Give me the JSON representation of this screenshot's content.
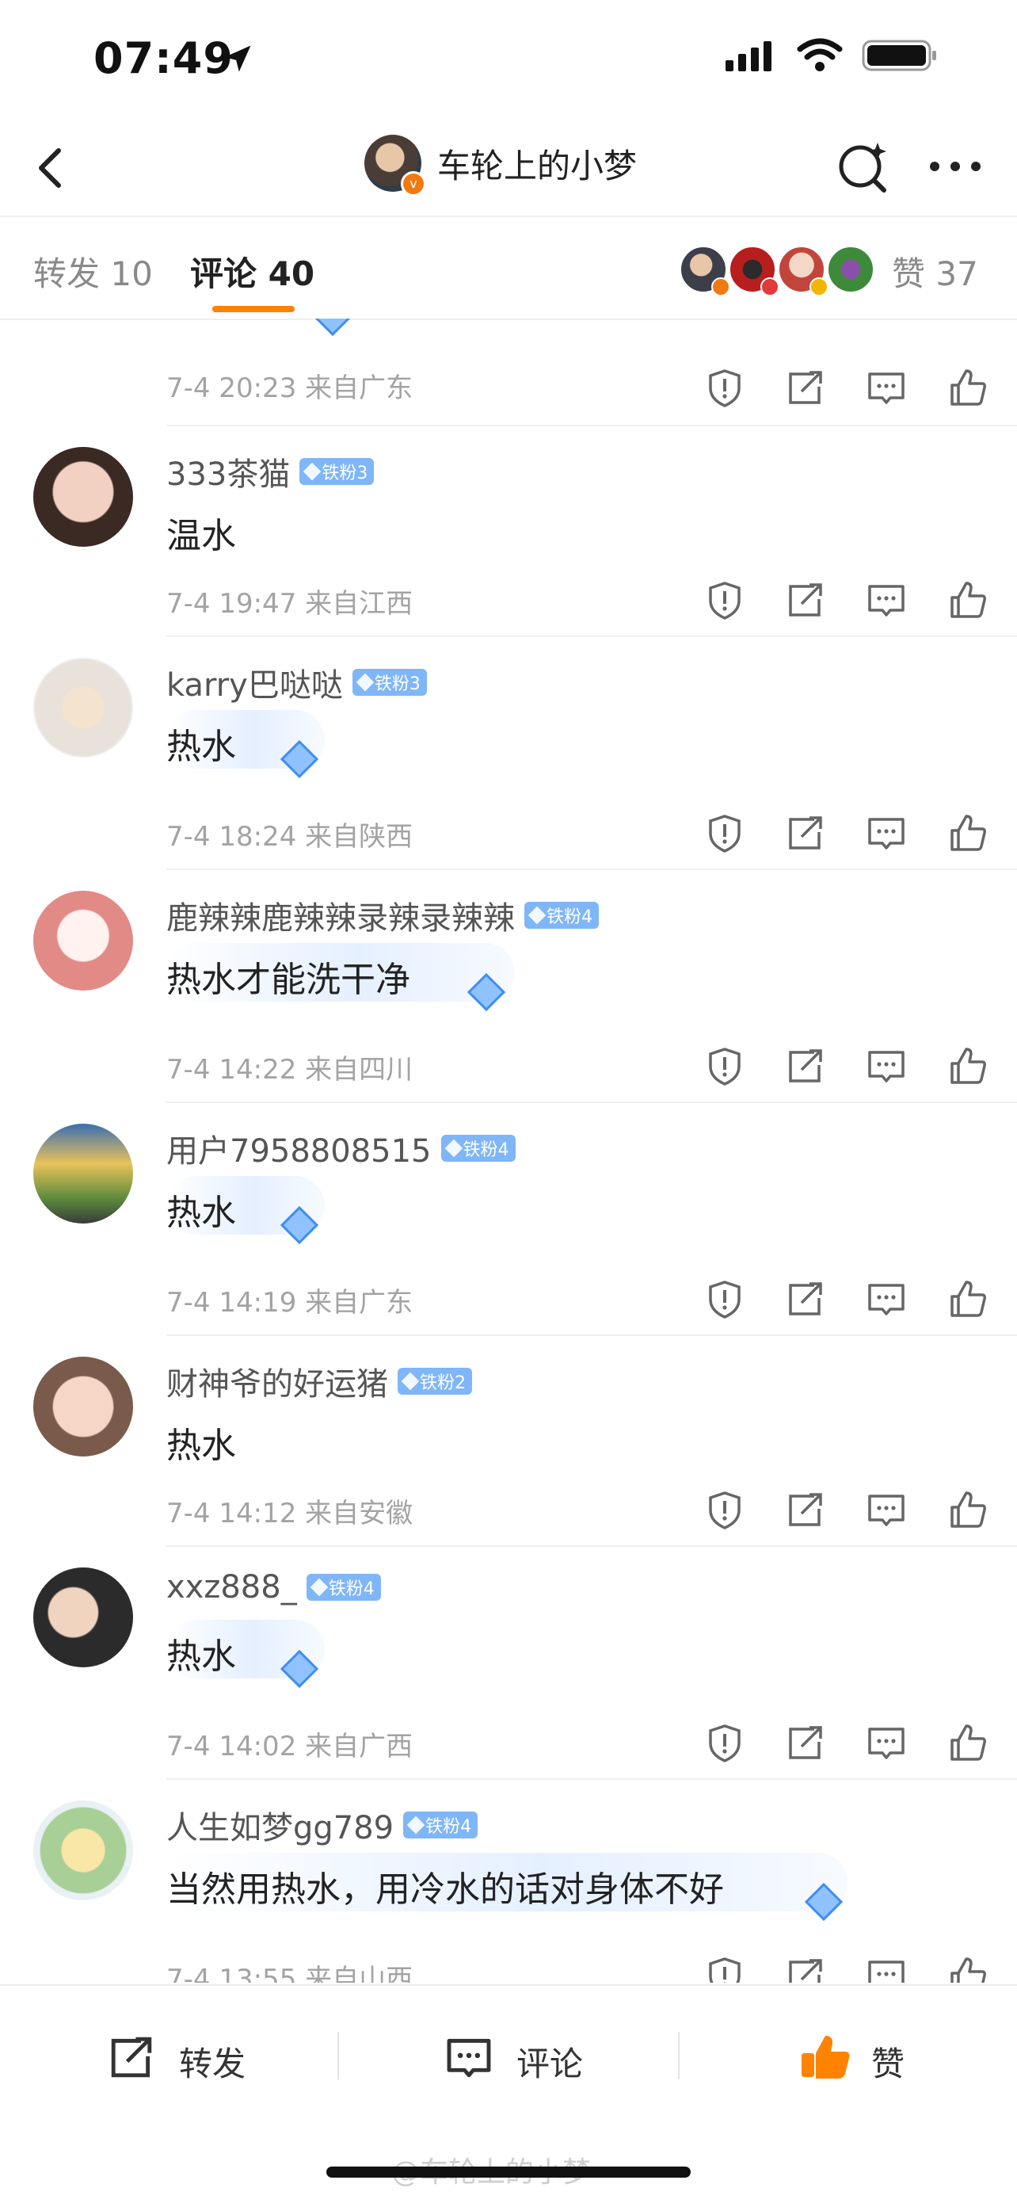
{
  "status_bar": {
    "time": "07:49"
  },
  "nav": {
    "title": "车轮上的小梦"
  },
  "tabs": {
    "repost": "转发 10",
    "comment": "评论 40",
    "likes": "赞 37"
  },
  "first_meta": "7-4 20:23 来自广东",
  "comments": [
    {
      "username": "333茶猫",
      "badge": "铁粉3",
      "text": "温水",
      "meta": "7-4 19:47 来自江西",
      "gem": false
    },
    {
      "username": "karry巴哒哒",
      "badge": "铁粉3",
      "text": "热水",
      "meta": "7-4 18:24 来自陕西",
      "gem": true
    },
    {
      "username": "鹿辣辣鹿辣辣录辣录辣辣",
      "badge": "铁粉4",
      "text": "热水才能洗干净",
      "meta": "7-4 14:22 来自四川",
      "gem": true
    },
    {
      "username": "用户7958808515",
      "badge": "铁粉4",
      "text": "热水",
      "meta": "7-4 14:19 来自广东",
      "gem": true
    },
    {
      "username": "财神爷的好运猪",
      "badge": "铁粉2",
      "text": "热水",
      "meta": "7-4 14:12 来自安徽",
      "gem": false
    },
    {
      "username": "xxz888_",
      "badge": "铁粉4",
      "text": "热水",
      "meta": "7-4 14:02 来自广西",
      "gem": true
    },
    {
      "username": "人生如梦gg789",
      "badge": "铁粉4",
      "text": "当然用热水，用冷水的话对身体不好",
      "meta": "7-4 13:55 来自山西",
      "gem": true
    }
  ],
  "bottom_bar": {
    "repost": "转发",
    "comment": "评论",
    "like": "赞"
  },
  "watermark": "@车轮上的小梦",
  "icons": [
    "location-arrow-icon",
    "cellular-signal-icon",
    "wifi-icon",
    "battery-icon",
    "back-chevron-icon",
    "ai-search-icon",
    "more-dots-icon",
    "report-icon",
    "share-icon",
    "comment-icon",
    "thumbs-up-icon"
  ],
  "colors": {
    "accent": "#ff8200",
    "fan_badge": "#7fb6f7",
    "meta_gray": "#a3a3a3"
  }
}
